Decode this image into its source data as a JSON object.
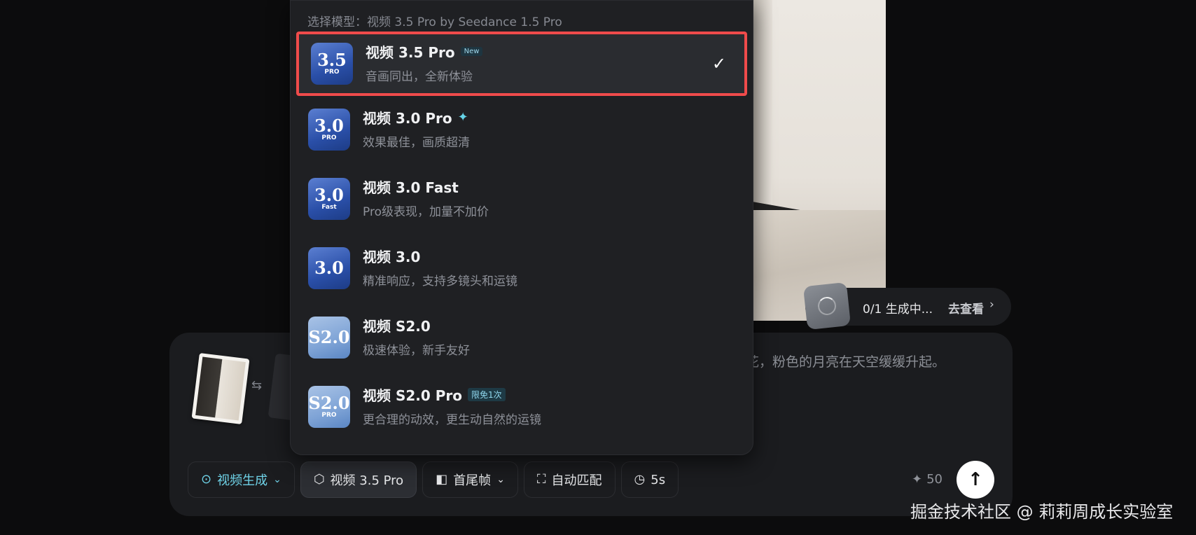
{
  "dropdown": {
    "header": "选择模型：视频 3.5 Pro by Seedance 1.5 Pro",
    "models": [
      {
        "icon_text": "3.5",
        "icon_sub": "PRO",
        "name": "视频 3.5 Pro",
        "badge": "New",
        "description": "音画同出，全新体验",
        "selected": true
      },
      {
        "icon_text": "3.0",
        "icon_sub": "PRO",
        "name": "视频 3.0 Pro",
        "badge": "",
        "sparkle": "✦",
        "description": "效果最佳，画质超清",
        "selected": false
      },
      {
        "icon_text": "3.0",
        "icon_sub": "Fast",
        "name": "视频 3.0 Fast",
        "badge": "",
        "description": "Pro级表现，加量不加价",
        "selected": false
      },
      {
        "icon_text": "3.0",
        "icon_sub": "",
        "name": "视频 3.0",
        "badge": "",
        "description": "精准响应，支持多镜头和运镜",
        "selected": false
      },
      {
        "icon_text": "S2.0",
        "icon_sub": "",
        "name": "视频 S2.0",
        "badge": "",
        "description": "极速体验，新手友好",
        "selected": false
      },
      {
        "icon_text": "S2.0",
        "icon_sub": "PRO",
        "name": "视频 S2.0 Pro",
        "badge": "限免1次",
        "description": "更合理的动效，更生动自然的运镜",
        "selected": false
      }
    ]
  },
  "progress": {
    "status": "0/1  生成中...",
    "link": "去查看",
    "chevron": "›"
  },
  "composer": {
    "prompt": "花，粉色的月亮在天空缓缓升起。",
    "swap_icon": "⇆",
    "toolbar": {
      "mode_label": "视频生成",
      "model_label": "视频 3.5 Pro",
      "frames_label": "首尾帧",
      "ratio_label": "自动匹配",
      "duration_label": "5s"
    },
    "credits": "50",
    "credits_icon": "✦",
    "send_icon": "↑"
  },
  "watermark": "掘金技术社区 @ 莉莉周成长实验室",
  "colors": {
    "accent": "#6fd3e8",
    "highlight_border": "#ef4b4b",
    "panel": "#1b1c1f"
  }
}
